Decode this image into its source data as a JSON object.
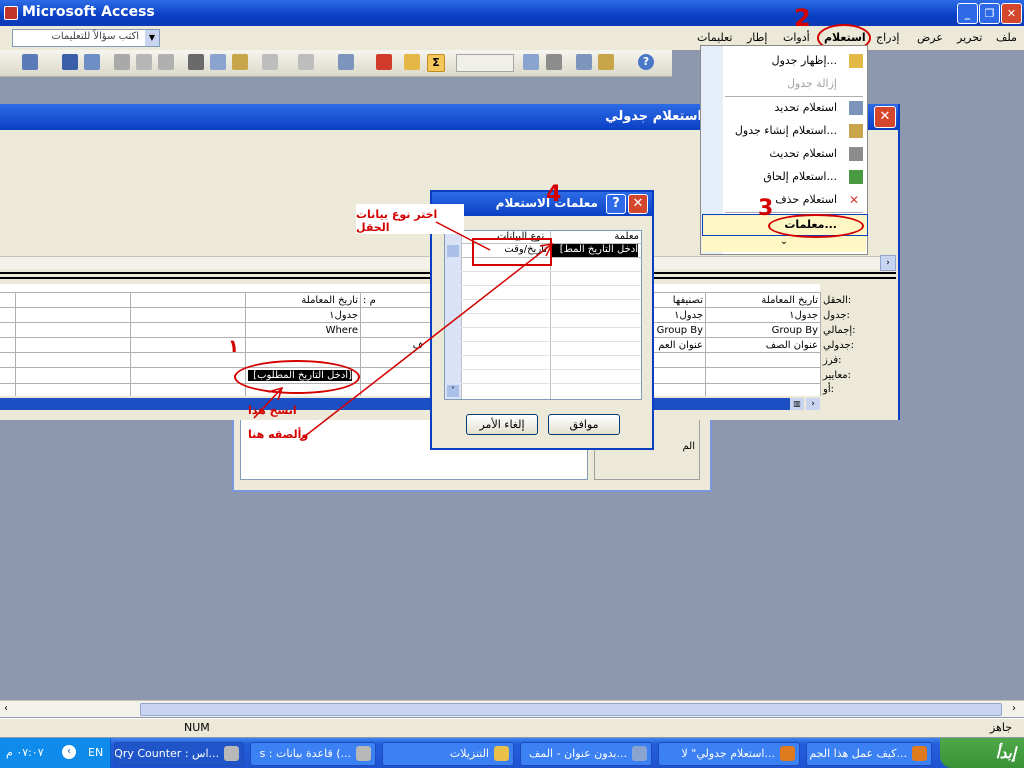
{
  "window": {
    "title": "Microsoft Access"
  },
  "menubar": {
    "items": [
      "ملف",
      "تحرير",
      "عرض",
      "إدراج",
      "استعلام",
      "أدوات",
      "إطار",
      "تعليمات"
    ],
    "ask_placeholder": "اكتب سؤالاً للتعليمات"
  },
  "query_window": {
    "title": "استعلام جدولي"
  },
  "query_menu": {
    "items": [
      "إظهار جدول...",
      "إزالة جدول",
      "استعلام تحديد",
      "استعلام إنشاء جدول...",
      "استعلام تحديث",
      "استعلام إلحاق...",
      "استعلام حذف",
      "معلمات..."
    ]
  },
  "design_grid": {
    "row_labels": [
      "الحقل:",
      "جدول:",
      "إجمالي:",
      "جدولي:",
      "فرز:",
      "معايير:",
      "أو:"
    ],
    "columns": [
      {
        "field": "تاريخ المعاملة",
        "table": "جدول١",
        "total": "Group By",
        "crosstab": "عنوان الصف",
        "criteria": ""
      },
      {
        "field": "تصنيفها",
        "table": "جدول١",
        "total": "Group By",
        "crosstab": "عنوان العم",
        "criteria": ""
      },
      {
        "field": ": م",
        "table": "",
        "total": "",
        "crosstab": "ف",
        "criteria": ""
      },
      {
        "field": "تاريخ المعاملة",
        "table": "جدول١",
        "total": "Where",
        "crosstab": "",
        "criteria": "[أدخل التاريخ المطلوب]"
      }
    ]
  },
  "param_dialog": {
    "title": "معلمات الاستعلام",
    "header_param": "معلمة",
    "header_type": "نوع البيانات",
    "param_value": "[أدخل التاريخ المط",
    "type_value": "تاريخ/وقت",
    "ok": "موافق",
    "cancel": "إلغاء الأمر"
  },
  "back_dialog": {
    "label": "الم"
  },
  "annotations": {
    "choose_type": "اختر نوع بيانات الحقل",
    "copy_paste_1": "انسخ هذا",
    "copy_paste_2": "وألصقه هنا",
    "num1": "١",
    "num2": "2",
    "num3": "3",
    "num4": "4"
  },
  "status": {
    "ready": "جاهز",
    "num": "NUM"
  },
  "taskbar": {
    "start": "إبدأ",
    "tasks": [
      "كيف عمل هذا الجم...",
      "استعلام جدولي\" لا...",
      "بدون عنوان - المف...",
      "التنزيلات",
      "s : قاعدة بيانات (...",
      "Qry Counter : اس..."
    ],
    "lang": "EN",
    "clock": "٠٧:٠٧ م"
  },
  "colors": {
    "accent": "#0a3fc4",
    "annotation": "#d40000",
    "start": "#3a9236"
  }
}
